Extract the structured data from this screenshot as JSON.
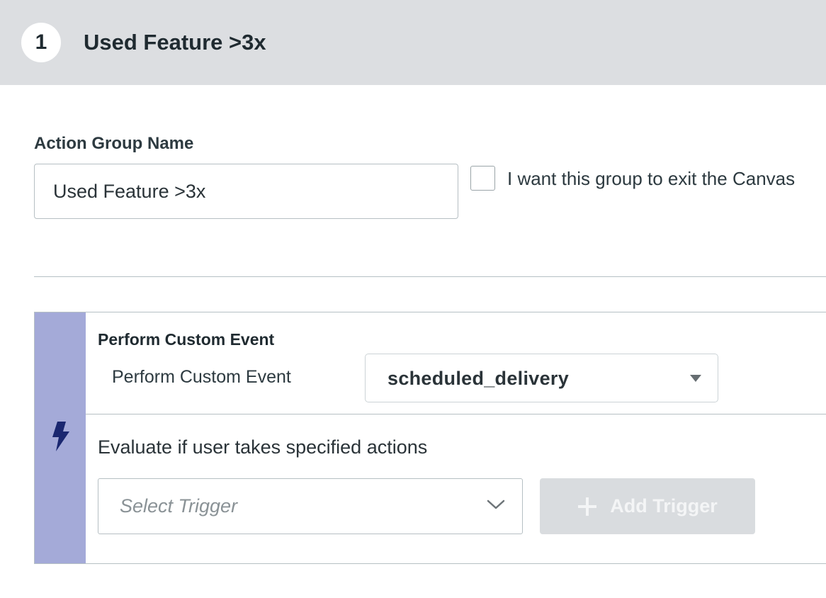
{
  "header": {
    "step_number": "1",
    "title": "Used Feature >3x"
  },
  "group_form": {
    "name_label": "Action Group Name",
    "name_value": "Used Feature >3x",
    "exit_checkbox_label": "I want this group to exit the Canvas",
    "exit_checked": false
  },
  "action_panel": {
    "icon": "lightning-bolt-icon",
    "rail_color": "#a4aad8",
    "section_title": "Perform Custom Event",
    "event_label": "Perform Custom Event",
    "event_selected": "scheduled_delivery",
    "evaluate_label": "Evaluate if user takes specified actions",
    "trigger_placeholder": "Select Trigger",
    "add_trigger_label": "Add Trigger",
    "add_trigger_disabled": true
  }
}
